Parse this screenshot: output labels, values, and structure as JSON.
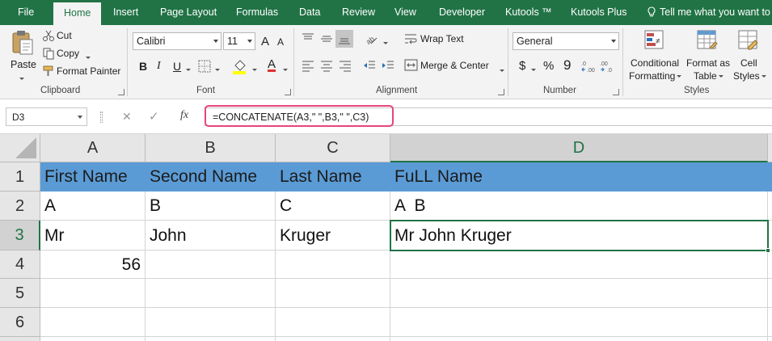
{
  "menu": {
    "file": "File",
    "tabs": [
      "Home",
      "Insert",
      "Page Layout",
      "Formulas",
      "Data",
      "Review",
      "View",
      "Developer",
      "Kutools ™",
      "Kutools Plus"
    ],
    "tell_me": "Tell me what you want to d"
  },
  "ribbon": {
    "clipboard": {
      "paste": "Paste",
      "cut": "Cut",
      "copy": "Copy",
      "format_painter": "Format Painter",
      "label": "Clipboard"
    },
    "font": {
      "name": "Calibri",
      "size": "11",
      "label": "Font",
      "bold": "B",
      "italic": "I",
      "underline": "U",
      "grow": "A",
      "shrink": "A",
      "font_color_letter": "A"
    },
    "alignment": {
      "wrap_text": "Wrap Text",
      "merge_center": "Merge & Center",
      "label": "Alignment"
    },
    "number": {
      "format": "General",
      "currency": "$",
      "percent": "%",
      "comma": "9",
      "label": "Number"
    },
    "styles": {
      "conditional": "Conditional",
      "formatting": "Formatting",
      "format_as": "Format as",
      "table": "Table",
      "cell": "Cell",
      "cell_styles": "Styles",
      "label": "Styles"
    }
  },
  "formula_bar": {
    "name_box": "D3",
    "cancel": "✕",
    "enter": "✓",
    "fx": "fx",
    "formula": "=CONCATENATE(A3,\" \",B3,\" \",C3)"
  },
  "sheet": {
    "columns": [
      "A",
      "B",
      "C",
      "D"
    ],
    "rows": [
      "1",
      "2",
      "3",
      "4",
      "5",
      "6"
    ],
    "cells": {
      "A1": "First Name",
      "B1": "Second Name",
      "C1": "Last Name",
      "D1": "FuLL Name",
      "A2": "A",
      "B2": "B",
      "C2": "C",
      "D2": "A  B",
      "A3": "Mr",
      "B3": "John",
      "C3": "Kruger",
      "D3": "Mr John Kruger",
      "A4": "56"
    },
    "selected_cell": "D3",
    "header_fill": "#5b9bd5"
  },
  "colors": {
    "accent": "#217346",
    "highlight": "#e8457a"
  }
}
